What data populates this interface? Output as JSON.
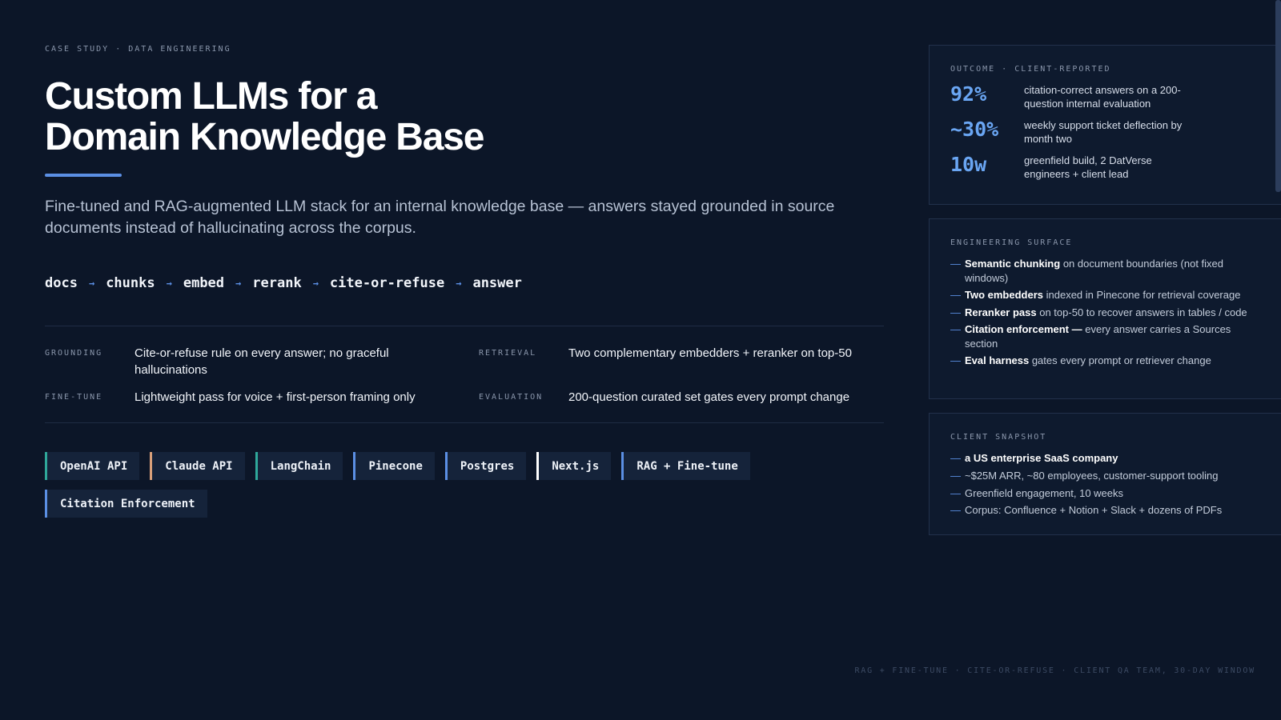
{
  "eyebrow": "CASE STUDY · DATA ENGINEERING",
  "title": {
    "line1": "Custom LLMs for a",
    "line2": "Domain Knowledge Base"
  },
  "lede": "Fine-tuned and RAG-augmented LLM stack for an internal knowledge base — answers stayed grounded in source documents instead of hallucinating across the corpus.",
  "pipeline": {
    "steps": [
      "docs",
      "chunks",
      "embed",
      "rerank",
      "cite-or-refuse",
      "answer"
    ],
    "arrow": "→"
  },
  "facts": [
    {
      "key": "GROUNDING",
      "value": "Cite-or-refuse rule on every answer; no graceful hallucinations"
    },
    {
      "key": "RETRIEVAL",
      "value": "Two complementary embedders + reranker on top-50"
    },
    {
      "key": "FINE-TUNE",
      "value": "Lightweight pass for voice + first-person framing only"
    },
    {
      "key": "EVALUATION",
      "value": "200-question curated set gates every prompt change"
    }
  ],
  "tags": [
    {
      "label": "OpenAI API",
      "color": "#2fa89a"
    },
    {
      "label": "Claude API",
      "color": "#d9a07a"
    },
    {
      "label": "LangChain",
      "color": "#2fa89a"
    },
    {
      "label": "Pinecone",
      "color": "#5b8fe4"
    },
    {
      "label": "Postgres",
      "color": "#5b8fe4"
    },
    {
      "label": "Next.js",
      "color": "#ffffff"
    },
    {
      "label": "RAG + Fine-tune",
      "color": "#5b8fe4"
    },
    {
      "label": "Citation Enforcement",
      "color": "#5b8fe4"
    }
  ],
  "outcome": {
    "label": "OUTCOME · CLIENT-REPORTED",
    "stats": [
      {
        "num": "92%",
        "desc": "citation-correct answers on a 200-question internal evaluation"
      },
      {
        "num": "~30%",
        "desc": "weekly support ticket deflection by month two"
      },
      {
        "num": "10w",
        "desc": "greenfield build, 2 DatVerse engineers + client lead"
      }
    ]
  },
  "engineering": {
    "label": "ENGINEERING SURFACE",
    "items": [
      {
        "strong": "Semantic chunking",
        "rest": " on document boundaries (not fixed windows)"
      },
      {
        "strong": "Two embedders",
        "rest": " indexed in Pinecone for retrieval coverage"
      },
      {
        "strong": "Reranker pass",
        "rest": " on top-50 to recover answers in tables / code"
      },
      {
        "strong": "Citation enforcement —",
        "rest": " every answer carries a Sources section"
      },
      {
        "strong": "Eval harness",
        "rest": " gates every prompt or retriever change"
      }
    ]
  },
  "client": {
    "label": "CLIENT SNAPSHOT",
    "items": [
      "a US enterprise SaaS company",
      "~$25M ARR, ~80 employees, customer-support tooling",
      "Greenfield engagement, 10 weeks",
      "Corpus: Confluence + Notion + Slack + dozens of PDFs"
    ]
  },
  "bullet_dash": "—",
  "footer": "RAG + FINE-TUNE · CITE-OR-REFUSE · CLIENT QA TEAM, 30-DAY WINDOW",
  "colors": {
    "background": "#0c1628",
    "accent": "#5b8fe4",
    "stat": "#6aa6f3",
    "teal": "#2fa89a",
    "tan": "#d9a07a"
  }
}
